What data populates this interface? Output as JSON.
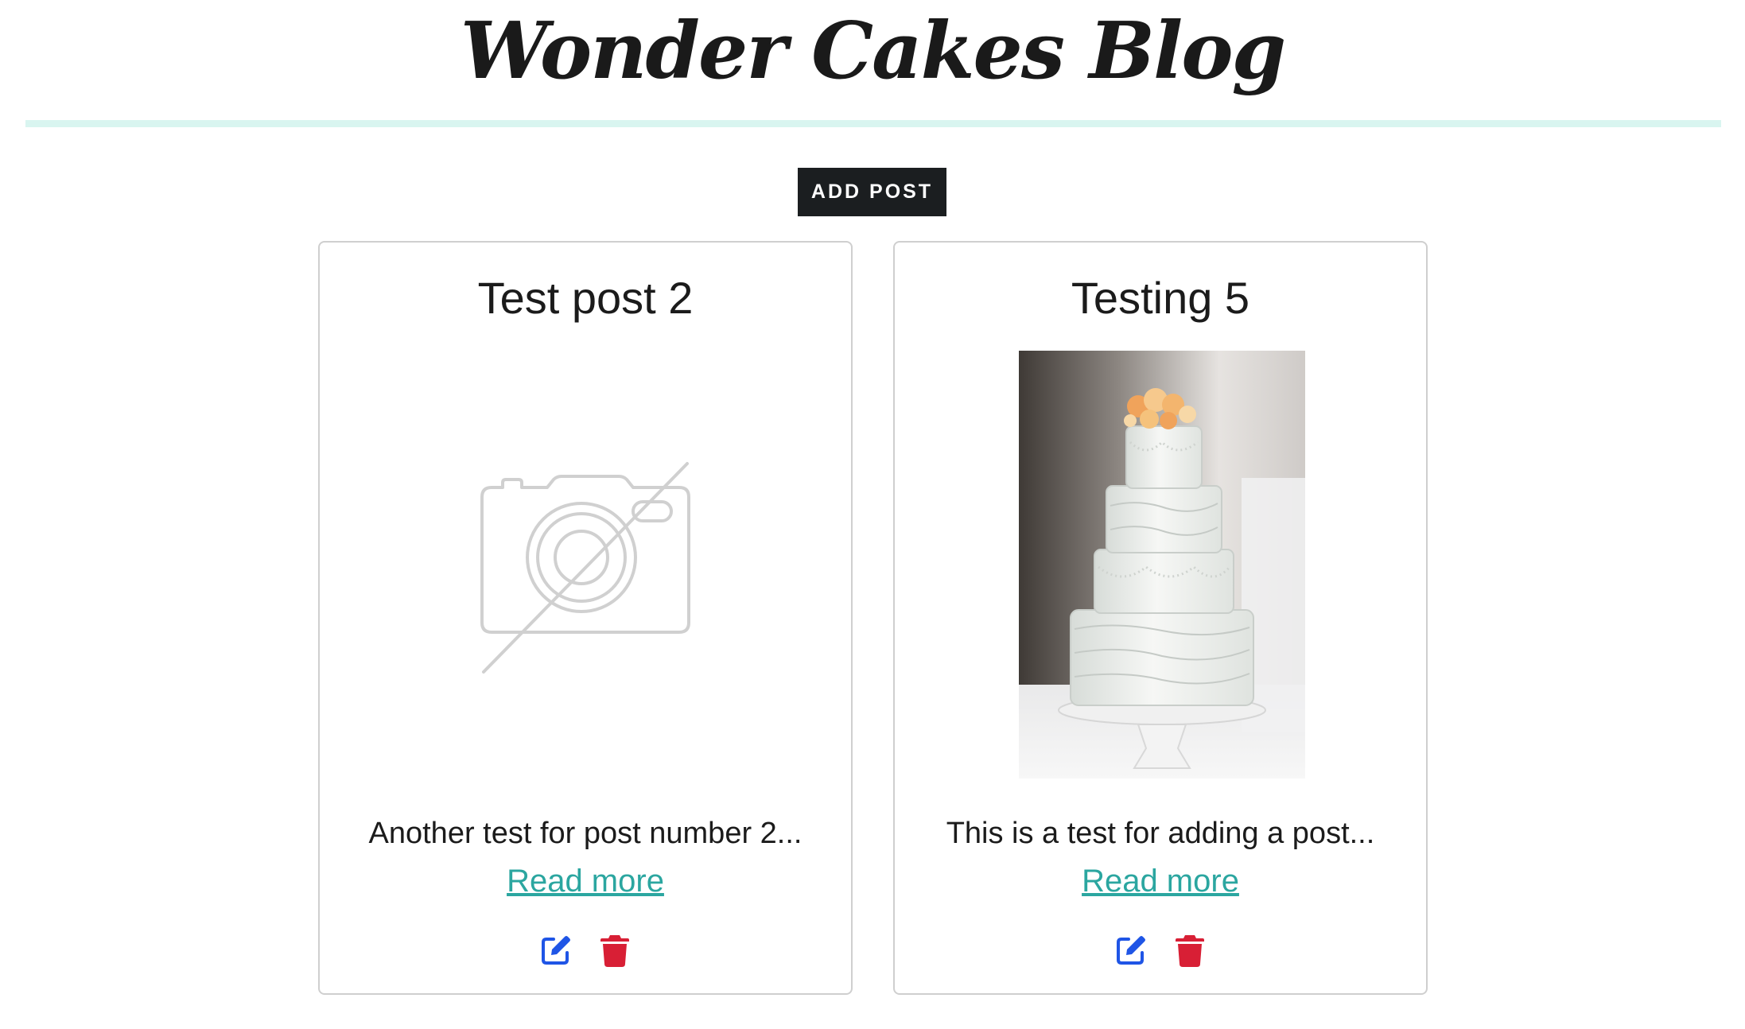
{
  "header": {
    "title": "Wonder Cakes Blog"
  },
  "toolbar": {
    "add_post_label": "ADD POST"
  },
  "posts": [
    {
      "title": "Test post 2",
      "excerpt": "Another test for post number 2...",
      "read_more_label": "Read more",
      "image": "no-image-placeholder-icon"
    },
    {
      "title": "Testing 5",
      "excerpt": "This is a test for adding a post...",
      "read_more_label": "Read more",
      "image": "wedding-cake-photo"
    }
  ],
  "icons": {
    "edit": "edit-icon",
    "delete": "trash-icon"
  },
  "colors": {
    "accent_rule": "#d9f5f0",
    "button_bg": "#1b1e20",
    "link": "#2ba6a0",
    "edit_icon": "#1f55e6",
    "delete_icon": "#d81f35"
  }
}
